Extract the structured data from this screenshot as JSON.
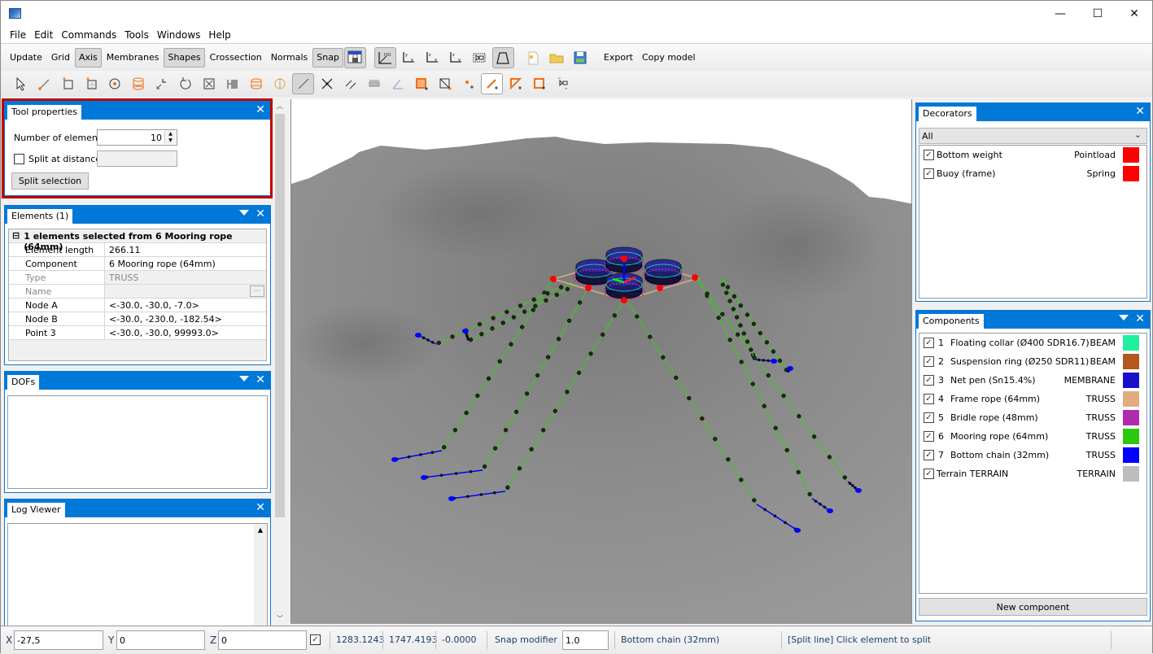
{
  "window": {
    "minimize": "—",
    "maximize": "☐",
    "close": "✕"
  },
  "menu": [
    "File",
    "Edit",
    "Commands",
    "Tools",
    "Windows",
    "Help"
  ],
  "toolbar1": {
    "buttons": [
      {
        "label": "Update",
        "active": false
      },
      {
        "label": "Grid",
        "active": false
      },
      {
        "label": "Axis",
        "active": true
      },
      {
        "label": "Membranes",
        "active": false
      },
      {
        "label": "Shapes",
        "active": true
      },
      {
        "label": "Crossection",
        "active": false
      },
      {
        "label": "Normals",
        "active": false
      },
      {
        "label": "Snap",
        "active": true
      }
    ],
    "view_icons": [
      "lock-view-icon",
      "iso-view-icon",
      "xy-view-icon",
      "xz-view-icon",
      "yz-view-icon",
      "zoom-extents-icon",
      "perspective-icon"
    ],
    "file_icons": [
      "new-file-icon",
      "open-folder-icon",
      "save-icon"
    ],
    "export_label": "Export",
    "copy_model_label": "Copy model"
  },
  "toolbar2": {
    "icons": [
      "select-arrow-icon",
      "add-line-icon",
      "add-rectangle-icon",
      "add-grid-rectangle-icon",
      "add-circle-icon",
      "add-cylinder-icon",
      "move-icon",
      "rotate-icon",
      "scale-icon",
      "array-icon",
      "cylinder-outline-icon",
      "sphere-section-icon",
      "split-line-icon",
      "intersect-icon",
      "parallel-lines-icon",
      "align-icon",
      "angle-icon",
      "fill-rect-icon",
      "rect-diagonal-icon",
      "add-node-icon",
      "add-line-plus-icon",
      "add-triangle-icon",
      "add-quad-icon",
      "connect-icon"
    ],
    "active_index": 12,
    "highlight_index": 20
  },
  "tool_properties": {
    "title": "Tool properties",
    "number_of_elements_label": "Number of elements",
    "number_of_elements_value": "10",
    "split_at_distance_label": "Split at distance",
    "split_at_distance_checked": false,
    "split_at_distance_value": "",
    "split_button": "Split selection"
  },
  "elements": {
    "title": "Elements (1)",
    "header": "1 elements selected from 6 Mooring rope (64mm)",
    "rows": [
      {
        "key": "Element length",
        "value": "266.11",
        "grey": false
      },
      {
        "key": "Component",
        "value": "6 Mooring rope (64mm)",
        "grey": false
      },
      {
        "key": "Type",
        "value": "TRUSS",
        "grey": true
      },
      {
        "key": "Name",
        "value": "",
        "grey": true,
        "has_button": true
      },
      {
        "key": "Node A",
        "value": "<-30.0, -30.0, -7.0>",
        "grey": false
      },
      {
        "key": "Node B",
        "value": "<-30.0, -230.0, -182.54>",
        "grey": false
      },
      {
        "key": "Point 3",
        "value": "<-30.0, -30.0, 99993.0>",
        "grey": false
      }
    ],
    "dots": "..."
  },
  "dofs": {
    "title": "DOFs"
  },
  "log_viewer": {
    "title": "Log Viewer"
  },
  "decorators": {
    "title": "Decorators",
    "filter": "All",
    "items": [
      {
        "name": "Bottom weight",
        "type": "Pointload",
        "color": "#ff0000",
        "checked": true
      },
      {
        "name": "Buoy (frame)",
        "type": "Spring",
        "color": "#ff0000",
        "checked": true
      }
    ]
  },
  "components": {
    "title": "Components",
    "items": [
      {
        "num": "1",
        "name": "Floating collar (Ø400 SDR16.7)",
        "type": "BEAM",
        "color": "#1ef0a0",
        "checked": true
      },
      {
        "num": "2",
        "name": "Suspension ring (Ø250 SDR11)",
        "type": "BEAM",
        "color": "#b5561e",
        "checked": true
      },
      {
        "num": "3",
        "name": "Net pen (Sn15.4%)",
        "type": "MEMBRANE",
        "color": "#1a0fc8",
        "checked": true
      },
      {
        "num": "4",
        "name": "Frame rope (64mm)",
        "type": "TRUSS",
        "color": "#e0ad80",
        "checked": true
      },
      {
        "num": "5",
        "name": "Bridle rope (48mm)",
        "type": "TRUSS",
        "color": "#b02ab0",
        "checked": true
      },
      {
        "num": "6",
        "name": "Mooring rope (64mm)",
        "type": "TRUSS",
        "color": "#2bc80f",
        "checked": true
      },
      {
        "num": "7",
        "name": "Bottom chain (32mm)",
        "type": "TRUSS",
        "color": "#0000ff",
        "checked": true
      },
      {
        "num": "",
        "name": "Terrain TERRAIN",
        "type": "TERRAIN",
        "color": "#bdbdbd",
        "checked": true
      }
    ],
    "new_button": "New component"
  },
  "statusbar": {
    "x_label": "X",
    "x_value": "-27,5",
    "y_label": "Y",
    "y_value": "0",
    "z_label": "Z",
    "z_value": "0",
    "lock_checked": true,
    "coord1": "1283.1243",
    "coord2": "1747.4193",
    "coord3": "-0.0000",
    "snap_label": "Snap modifier",
    "snap_value": "1.0",
    "current_component": "Bottom chain (32mm)",
    "message": "[Split line] Click element to split"
  },
  "colors": {
    "accent": "#0078d7",
    "highlight_border": "#c00000",
    "mooring": "#3cc81e",
    "chain": "#0000ff",
    "buoy": "#ff0000",
    "terrain": "#8c8c8c"
  }
}
